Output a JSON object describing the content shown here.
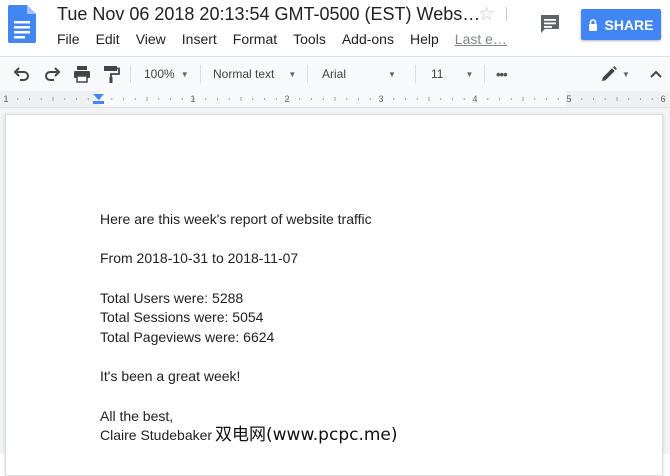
{
  "app": {
    "doc_title": "Tue Nov 06 2018 20:13:54 GMT-0500 (EST) Webs…",
    "share_label": "SHARE",
    "last_edit_label": "Last e…"
  },
  "menu": [
    "File",
    "Edit",
    "View",
    "Insert",
    "Format",
    "Tools",
    "Add-ons",
    "Help"
  ],
  "toolbar": {
    "zoom": "100%",
    "style": "Normal text",
    "font": "Arial",
    "size": "11",
    "more": "•••"
  },
  "ruler": {
    "numbers": [
      "1",
      "1",
      "2",
      "3",
      "4",
      "5",
      "6"
    ]
  },
  "document": {
    "lines": [
      "Here are this week's report of website traffic",
      "From 2018-10-31 to 2018-11-07",
      "Total Users were: 5288",
      "Total Sessions were: 5054",
      "Total Pageviews were: 6624",
      "It's been a great week!",
      "All the best,",
      "Claire Studebaker"
    ]
  },
  "watermark": "双电网(www.pcpc.me)",
  "colors": {
    "accent": "#4285f4",
    "doc_icon": "#4285f4"
  },
  "icons": [
    "docs-logo-icon",
    "star-icon",
    "comment-icon",
    "lock-icon",
    "undo-icon",
    "redo-icon",
    "print-icon",
    "paint-format-icon",
    "more-icon",
    "pencil-icon",
    "collapse-chevron-icon",
    "indent-marker-icon"
  ]
}
